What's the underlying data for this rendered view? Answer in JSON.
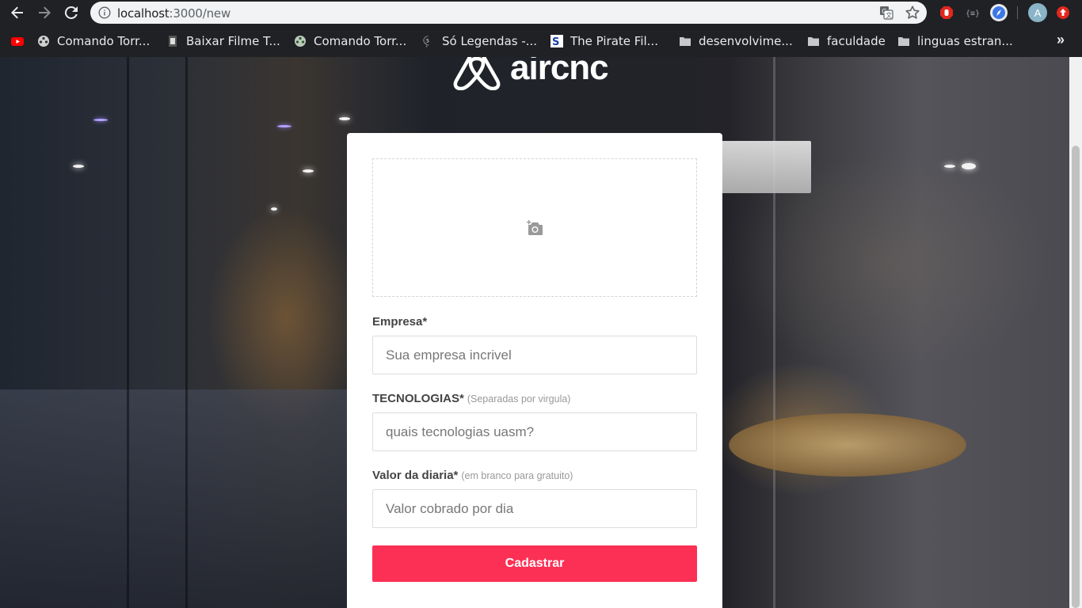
{
  "browser": {
    "url_host": "localhost",
    "url_path": ":3000/new",
    "avatar_letter": "A",
    "bookmarks": [
      {
        "label": "Comando Torr...",
        "icon": "film-reel-icon"
      },
      {
        "label": "Baixar Filme T...",
        "icon": "film-icon"
      },
      {
        "label": "Comando Torr...",
        "icon": "film-reel-icon"
      },
      {
        "label": "Só Legendas -...",
        "icon": "speech-bubble-icon"
      },
      {
        "label": "The Pirate Fil...",
        "icon": "pirate-s-icon"
      },
      {
        "label": "desenvolvime...",
        "icon": "folder-icon"
      },
      {
        "label": "faculdade",
        "icon": "folder-icon"
      },
      {
        "label": "linguas estran...",
        "icon": "folder-icon"
      }
    ],
    "more_label": "»"
  },
  "app": {
    "logo_text": "aircnc",
    "accent_color": "#fc3055"
  },
  "form": {
    "company_label": "Empresa*",
    "company_placeholder": "Sua empresa incrivel",
    "techs_label": "TECNOLOGIAS*",
    "techs_hint": "(Separadas por virgula)",
    "techs_placeholder": "quais tecnologias uasm?",
    "price_label": "Valor da diaria*",
    "price_hint": "(em branco para gratuito)",
    "price_placeholder": "Valor cobrado por dia",
    "submit_label": "Cadastrar"
  }
}
